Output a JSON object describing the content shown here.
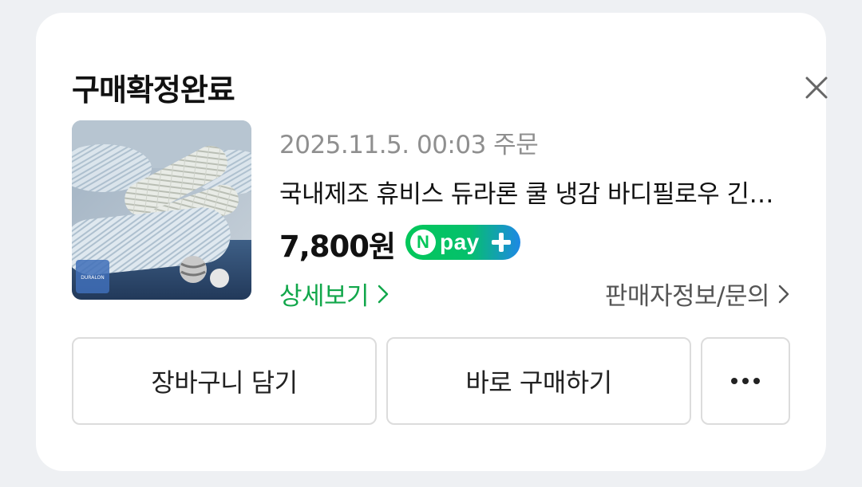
{
  "dialog": {
    "title": "구매확정완료"
  },
  "product": {
    "order_info": "2025.11.5. 00:03 주문",
    "name": "국내제조 휴비스 듀라론 쿨 냉감 바디필로우 긴베개",
    "price": "7,800원",
    "npay": {
      "n": "N",
      "label": "pay"
    },
    "thumbnail_brand": "DURALON"
  },
  "links": {
    "detail": "상세보기",
    "seller": "판매자정보/문의"
  },
  "actions": {
    "cart": "장바구니 담기",
    "buy_now": "바로 구매하기"
  },
  "colors": {
    "accent_green": "#12a74b",
    "npay_green": "#03c75a",
    "npay_blue": "#1e88e5"
  },
  "icons": [
    "close-icon",
    "chevron-right-icon",
    "more-icon",
    "plus-icon"
  ]
}
